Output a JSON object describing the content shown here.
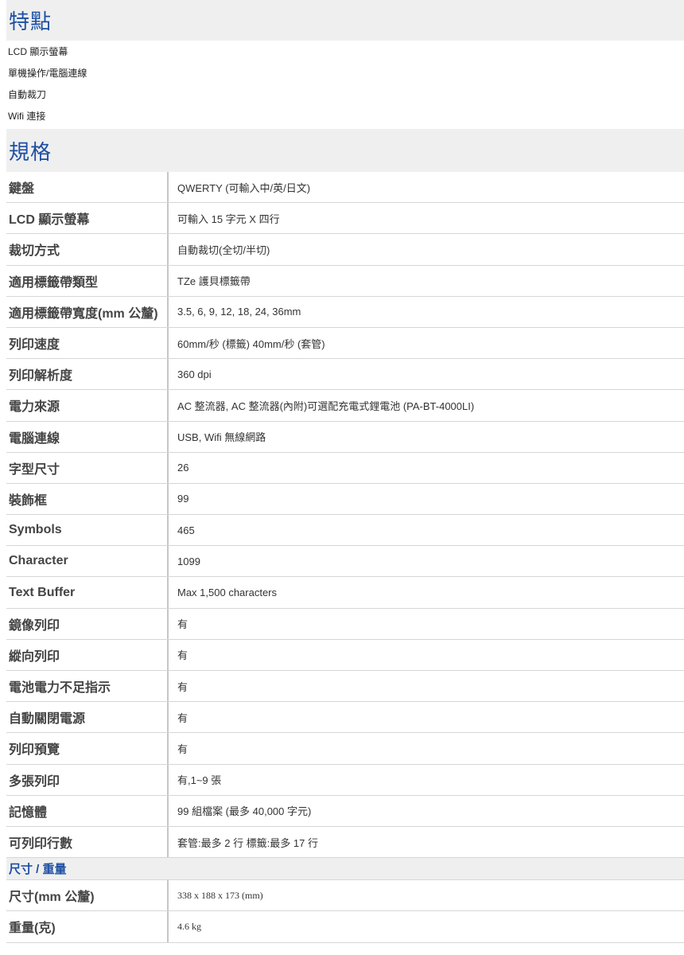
{
  "features": {
    "title": "特點",
    "items": [
      "LCD 顯示螢幕",
      "單機操作/電腦連線",
      "自動裁刀",
      "Wifi 連接"
    ]
  },
  "specs": {
    "title": "規格",
    "rows": [
      {
        "label": "鍵盤",
        "value": "QWERTY (可輸入中/英/日文)"
      },
      {
        "label": "LCD 顯示螢幕",
        "value": "可輸入 15 字元 X 四行"
      },
      {
        "label": "裁切方式",
        "value": "自動裁切(全切/半切)"
      },
      {
        "label": "適用標籤帶類型",
        "value": "TZe 護貝標籤帶"
      },
      {
        "label": "適用標籤帶寬度(mm 公釐)",
        "value": "3.5, 6, 9, 12, 18, 24, 36mm"
      },
      {
        "label": "列印速度",
        "value": "60mm/秒 (標籤) 40mm/秒 (套管)"
      },
      {
        "label": "列印解析度",
        "value": "360 dpi"
      },
      {
        "label": "電力來源",
        "value": "AC 整流器, AC 整流器(內附)可選配充電式鋰電池 (PA-BT-4000LI)"
      },
      {
        "label": "電腦連線",
        "value": "USB, Wifi 無線網路"
      },
      {
        "label": "字型尺寸",
        "value": "26"
      },
      {
        "label": "裝飾框",
        "value": "99"
      },
      {
        "label": "Symbols",
        "value": "465"
      },
      {
        "label": "Character",
        "value": "1099"
      },
      {
        "label": "Text Buffer",
        "value": "Max 1,500 characters"
      },
      {
        "label": "鏡像列印",
        "value": "有"
      },
      {
        "label": "縱向列印",
        "value": "有"
      },
      {
        "label": "電池電力不足指示",
        "value": "有"
      },
      {
        "label": "自動關閉電源",
        "value": "有"
      },
      {
        "label": "列印預覽",
        "value": "有"
      },
      {
        "label": "多張列印",
        "value": "有,1~9 張"
      },
      {
        "label": "記憶體",
        "value": "99 組檔案 (最多 40,000 字元)"
      },
      {
        "label": "可列印行數",
        "value": "套管:最多 2 行 標籤:最多 17 行"
      }
    ]
  },
  "dimensions": {
    "title": "尺寸 / 重量",
    "rows": [
      {
        "label": "尺寸(mm 公釐)",
        "value": "338 x 188 x 173 (mm)"
      },
      {
        "label": "重量(克)",
        "value": "4.6 kg"
      }
    ]
  }
}
